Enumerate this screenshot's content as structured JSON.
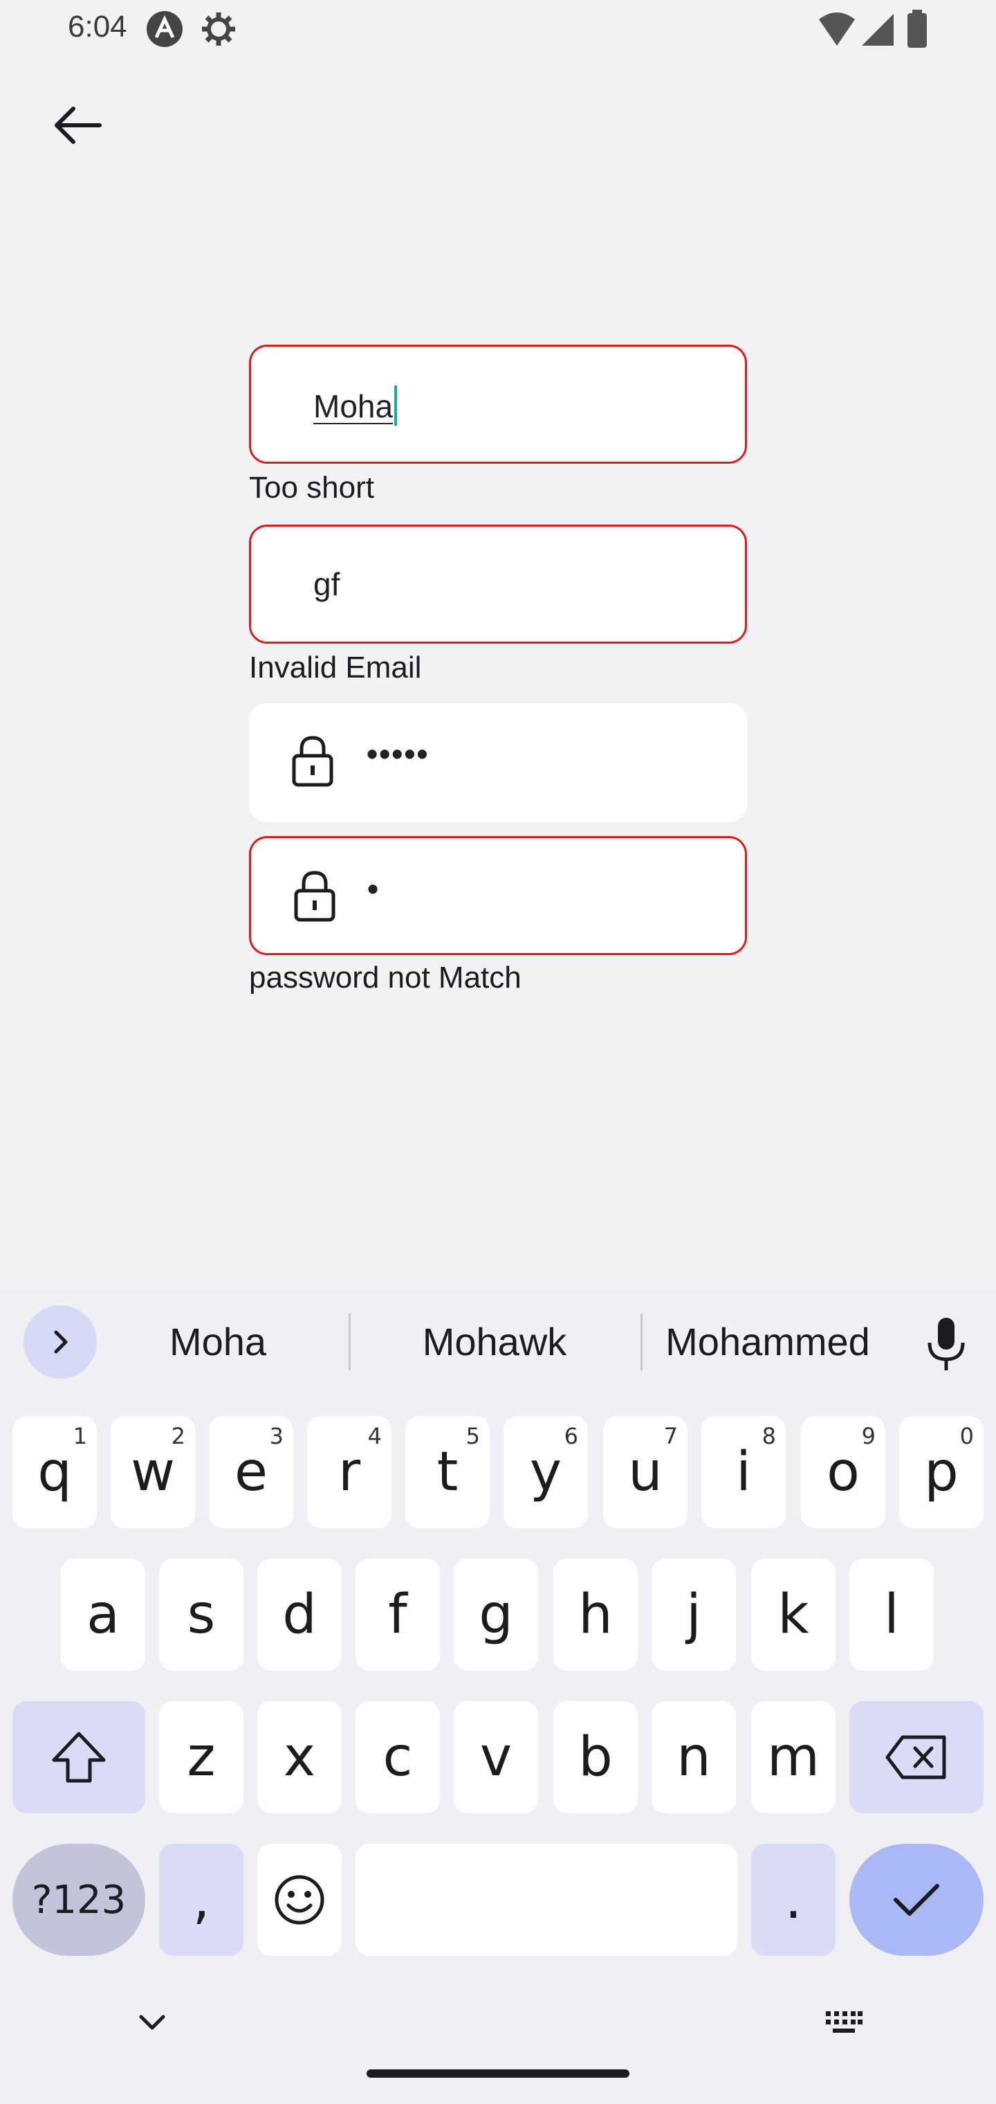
{
  "status_bar": {
    "time": "6:04",
    "icons": [
      "app-a-icon",
      "settings-gear-icon",
      "wifi-icon",
      "cell-signal-icon",
      "battery-icon"
    ]
  },
  "header": {
    "back_icon": "arrow-back-icon"
  },
  "form": {
    "name_field": {
      "value": "Moha",
      "error": "Too short"
    },
    "email_field": {
      "value": "gf",
      "error": "Invalid Email"
    },
    "password_field": {
      "value": "•••••"
    },
    "confirm_password_field": {
      "value": "•",
      "error": "password not Match"
    }
  },
  "keyboard": {
    "suggestions": [
      "Moha",
      "Mohawk",
      "Mohammed"
    ],
    "row1": [
      {
        "label": "q",
        "hint": "1"
      },
      {
        "label": "w",
        "hint": "2"
      },
      {
        "label": "e",
        "hint": "3"
      },
      {
        "label": "r",
        "hint": "4"
      },
      {
        "label": "t",
        "hint": "5"
      },
      {
        "label": "y",
        "hint": "6"
      },
      {
        "label": "u",
        "hint": "7"
      },
      {
        "label": "i",
        "hint": "8"
      },
      {
        "label": "o",
        "hint": "9"
      },
      {
        "label": "p",
        "hint": "0"
      }
    ],
    "row2": [
      "a",
      "s",
      "d",
      "f",
      "g",
      "h",
      "j",
      "k",
      "l"
    ],
    "row3": [
      "z",
      "x",
      "c",
      "v",
      "b",
      "n",
      "m"
    ],
    "symbols_label": "?123",
    "comma_label": ",",
    "period_label": "."
  },
  "colors": {
    "error_border": "#e01a1a",
    "caret": "#1aa7a0",
    "enter_key": "#aab9f6"
  }
}
